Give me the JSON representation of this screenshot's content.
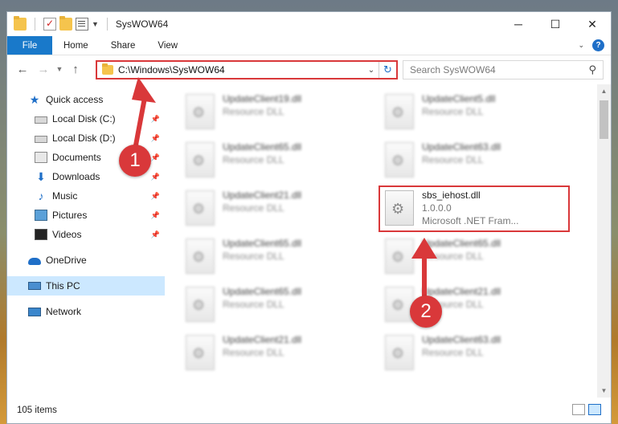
{
  "titlebar": {
    "title": "SysWOW64",
    "minimize": "─",
    "maximize": "☐",
    "close": "✕"
  },
  "ribbon": {
    "tabs": [
      "File",
      "Home",
      "Share",
      "View"
    ]
  },
  "navbar": {
    "address": "C:\\Windows\\SysWOW64",
    "search_placeholder": "Search SysWOW64"
  },
  "sidebar": {
    "items": [
      {
        "label": "Quick access",
        "icon": "star-icon",
        "pinned": false
      },
      {
        "label": "Local Disk (C:)",
        "icon": "drive-icon",
        "pinned": true
      },
      {
        "label": "Local Disk (D:)",
        "icon": "drive-icon",
        "pinned": true
      },
      {
        "label": "Documents",
        "icon": "documents-icon",
        "pinned": true
      },
      {
        "label": "Downloads",
        "icon": "download-icon",
        "pinned": true
      },
      {
        "label": "Music",
        "icon": "music-icon",
        "pinned": true
      },
      {
        "label": "Pictures",
        "icon": "pictures-icon",
        "pinned": true
      },
      {
        "label": "Videos",
        "icon": "videos-icon",
        "pinned": true
      },
      {
        "label": "OneDrive",
        "icon": "cloud-icon",
        "pinned": false
      },
      {
        "label": "This PC",
        "icon": "computer-icon",
        "pinned": false,
        "selected": true
      },
      {
        "label": "Network",
        "icon": "network-icon",
        "pinned": false
      }
    ]
  },
  "files": {
    "left_column": [
      {
        "name": "UpdateClient19.dll",
        "desc": "Resource DLL"
      },
      {
        "name": "UpdateClient65.dll",
        "desc": "Resource DLL"
      },
      {
        "name": "UpdateClient21.dll",
        "desc": "Resource DLL"
      },
      {
        "name": "UpdateClient65.dll",
        "desc": "Resource DLL"
      },
      {
        "name": "UpdateClient65.dll",
        "desc": "Resource DLL"
      },
      {
        "name": "UpdateClient21.dll",
        "desc": "Resource DLL"
      }
    ],
    "right_column": [
      {
        "name": "UpdateClient5.dll",
        "desc": "Resource DLL"
      },
      {
        "name": "UpdateClient63.dll",
        "desc": "Resource DLL"
      },
      {
        "name": "sbs_iehost.dll",
        "desc": "1.0.0.0",
        "desc2": "Microsoft .NET Fram...",
        "highlighted": true
      },
      {
        "name": "UpdateClient65.dll",
        "desc": "Resource DLL"
      },
      {
        "name": "UpdateClient21.dll",
        "desc": "Resource DLL"
      },
      {
        "name": "UpdateClient63.dll",
        "desc": "Resource DLL"
      }
    ]
  },
  "status": {
    "item_count": "105 items"
  },
  "annotations": {
    "badge1": "1",
    "badge2": "2",
    "color": "#d9383a"
  }
}
